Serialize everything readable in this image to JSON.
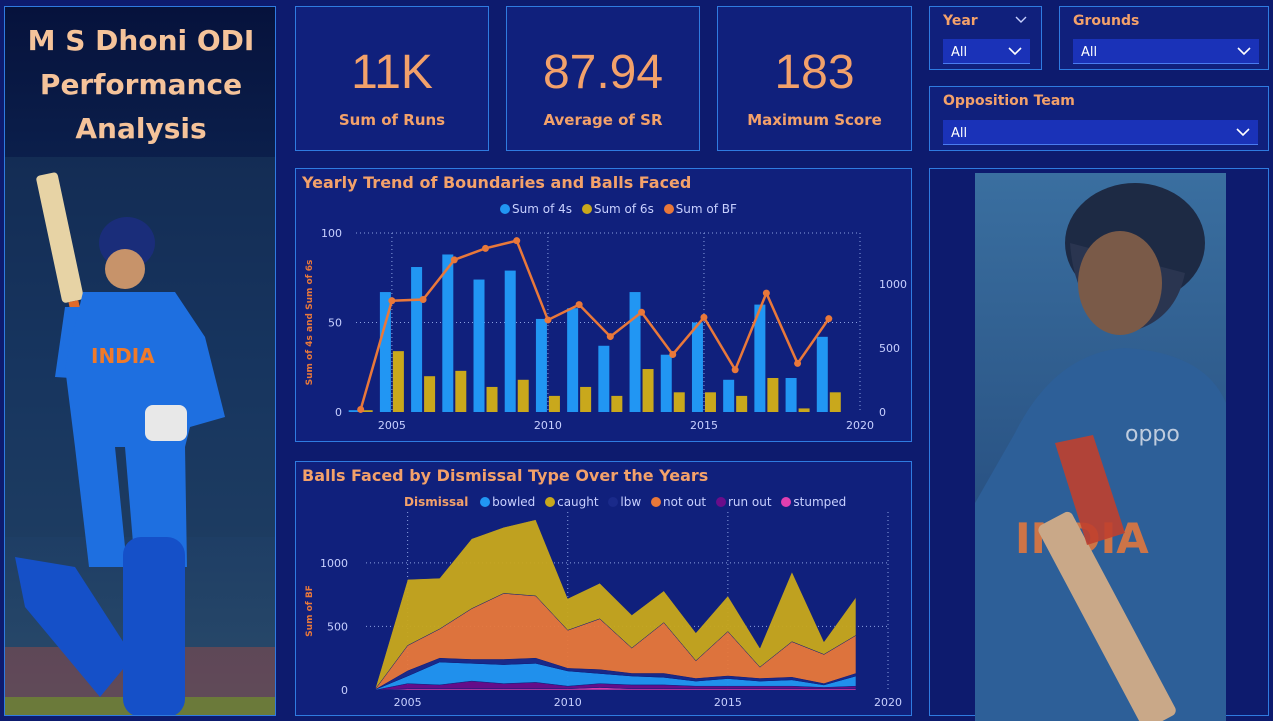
{
  "title": "M S Dhoni ODI Performance Analysis",
  "title_lines": [
    "M S Dhoni ODI",
    "Performance",
    "Analysis"
  ],
  "kpis": [
    {
      "value": "11K",
      "label": "Sum of Runs"
    },
    {
      "value": "87.94",
      "label": "Average of SR"
    },
    {
      "value": "183",
      "label": "Maximum Score"
    }
  ],
  "slicers": {
    "year": {
      "label": "Year",
      "value": "All"
    },
    "grounds": {
      "label": "Grounds",
      "value": "All"
    },
    "opposition": {
      "label": "Opposition Team",
      "value": "All"
    }
  },
  "images": {
    "left_photo": "player-batting-raising-bat",
    "right_photo": "player-looking-up-with-bat"
  },
  "colors": {
    "background": "#0d1b6e",
    "panel": "#10207c",
    "accent": "#f3a16a",
    "border": "#2f7be0",
    "fours": "#2196f3",
    "sixes": "#c9a81c",
    "bf": "#e9783a"
  },
  "chart_data": [
    {
      "type": "bar",
      "title": "Yearly Trend of Boundaries and Balls Faced",
      "ylabel": "Sum of 4s and Sum of 6s",
      "ylim": [
        0,
        100
      ],
      "y2lim": [
        0,
        1400
      ],
      "x_ticks": [
        "2005",
        "2010",
        "2015",
        "2020"
      ],
      "y_ticks": [
        "0",
        "50",
        "100"
      ],
      "y2_ticks": [
        "0",
        "500",
        "1000"
      ],
      "legend_position": "top",
      "categories": [
        2004,
        2005,
        2006,
        2007,
        2008,
        2009,
        2010,
        2011,
        2012,
        2013,
        2014,
        2015,
        2016,
        2017,
        2018,
        2019
      ],
      "series": [
        {
          "name": "Sum of 4s",
          "type": "bar",
          "color": "#2196f3",
          "values": [
            1,
            67,
            81,
            88,
            74,
            79,
            52,
            58,
            37,
            67,
            32,
            50,
            18,
            60,
            19,
            42
          ]
        },
        {
          "name": "Sum of 6s",
          "type": "bar",
          "color": "#c9a81c",
          "values": [
            1,
            34,
            20,
            23,
            14,
            18,
            9,
            14,
            9,
            24,
            11,
            11,
            9,
            19,
            2,
            11
          ]
        },
        {
          "name": "Sum of BF",
          "type": "line",
          "axis": "secondary",
          "color": "#e9783a",
          "values": [
            20,
            870,
            880,
            1190,
            1280,
            1340,
            720,
            840,
            590,
            780,
            450,
            740,
            330,
            930,
            380,
            730
          ]
        }
      ]
    },
    {
      "type": "area",
      "title": "Balls Faced by Dismissal Type Over the Years",
      "ylabel": "Sum of BF",
      "ylim": [
        0,
        1400
      ],
      "x_ticks": [
        "2005",
        "2010",
        "2015",
        "2020"
      ],
      "y_ticks": [
        "0",
        "500",
        "1000"
      ],
      "legend_title": "Dismissal",
      "legend_position": "top",
      "categories": [
        2004,
        2005,
        2006,
        2007,
        2008,
        2009,
        2010,
        2011,
        2012,
        2013,
        2014,
        2015,
        2016,
        2017,
        2018,
        2019
      ],
      "series": [
        {
          "name": "bowled",
          "color": "#2196f3",
          "values": [
            5,
            60,
            180,
            140,
            150,
            150,
            120,
            80,
            70,
            60,
            40,
            60,
            40,
            50,
            20,
            80
          ]
        },
        {
          "name": "caught",
          "color": "#c9a81c",
          "values": [
            10,
            520,
            400,
            550,
            520,
            600,
            250,
            280,
            260,
            250,
            220,
            280,
            150,
            550,
            100,
            300
          ]
        },
        {
          "name": "lbw",
          "color": "#1a2a8a",
          "values": [
            0,
            40,
            30,
            30,
            40,
            40,
            20,
            30,
            20,
            30,
            20,
            20,
            20,
            20,
            10,
            20
          ]
        },
        {
          "name": "not out",
          "color": "#e9783a",
          "values": [
            5,
            200,
            230,
            400,
            520,
            490,
            300,
            400,
            200,
            400,
            140,
            350,
            90,
            280,
            230,
            300
          ]
        },
        {
          "name": "run out",
          "color": "#6a0d8a",
          "values": [
            0,
            40,
            30,
            60,
            40,
            50,
            20,
            30,
            30,
            30,
            20,
            20,
            20,
            20,
            10,
            20
          ]
        },
        {
          "name": "stumped",
          "color": "#e03fb0",
          "values": [
            0,
            10,
            10,
            10,
            10,
            10,
            10,
            20,
            10,
            10,
            10,
            10,
            10,
            10,
            10,
            10
          ]
        }
      ]
    }
  ]
}
